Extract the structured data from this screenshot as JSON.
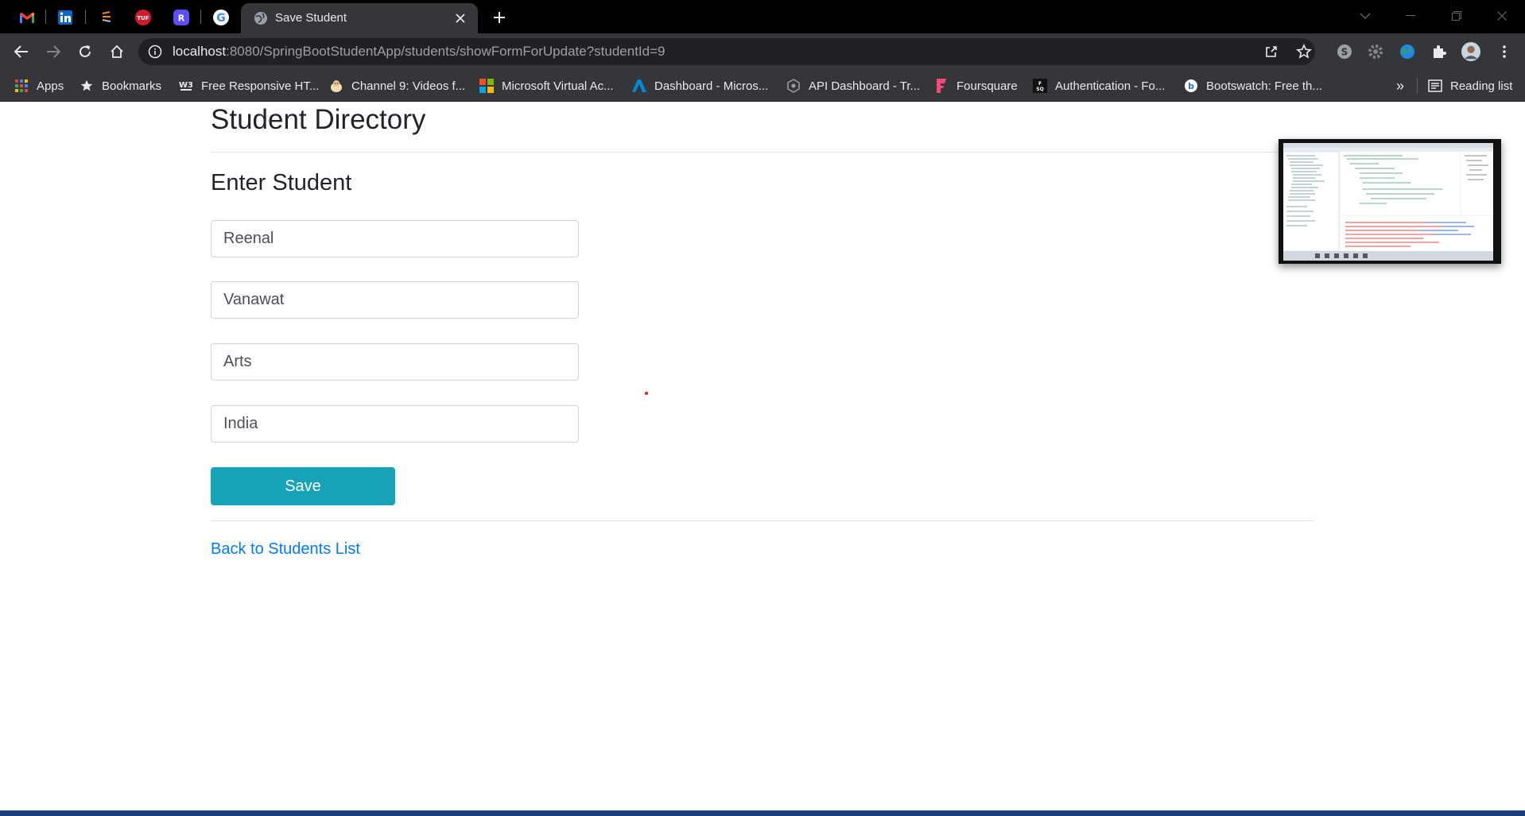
{
  "browser": {
    "pinned_tabs": [
      {
        "name": "gmail"
      },
      {
        "name": "linkedin"
      },
      {
        "name": "sololearn"
      },
      {
        "name": "tuf"
      },
      {
        "name": "r-app"
      },
      {
        "name": "google"
      }
    ],
    "active_tab": {
      "title": "Save Student"
    },
    "address": {
      "host": "localhost",
      "path": ":8080/SpringBootStudentApp/students/showFormForUpdate?studentId=9"
    },
    "bookmarks": [
      {
        "label": "Apps",
        "icon": "apps-grid-icon"
      },
      {
        "label": "Bookmarks",
        "icon": "star-icon"
      },
      {
        "label": "Free Responsive HT...",
        "icon": "w3-icon"
      },
      {
        "label": "Channel 9: Videos f...",
        "icon": "channel9-icon"
      },
      {
        "label": "Microsoft Virtual Ac...",
        "icon": "microsoft-icon"
      },
      {
        "label": "Dashboard - Micros...",
        "icon": "azure-icon"
      },
      {
        "label": "API Dashboard - Tr...",
        "icon": "api-icon"
      },
      {
        "label": "Foursquare",
        "icon": "foursquare-icon"
      },
      {
        "label": "Authentication - Fo...",
        "icon": "fsq-icon"
      },
      {
        "label": "Bootswatch: Free th...",
        "icon": "bootswatch-icon"
      }
    ],
    "overflow": "»",
    "reading_list": "Reading list"
  },
  "page": {
    "title": "Student Directory",
    "subtitle": "Enter Student",
    "form": {
      "first_name": "Reenal",
      "last_name": "Vanawat",
      "department": "Arts",
      "country": "India",
      "save_label": "Save"
    },
    "back_link": "Back to Students List"
  },
  "colors": {
    "save_button": "#17a2b8",
    "link": "#007bff"
  }
}
